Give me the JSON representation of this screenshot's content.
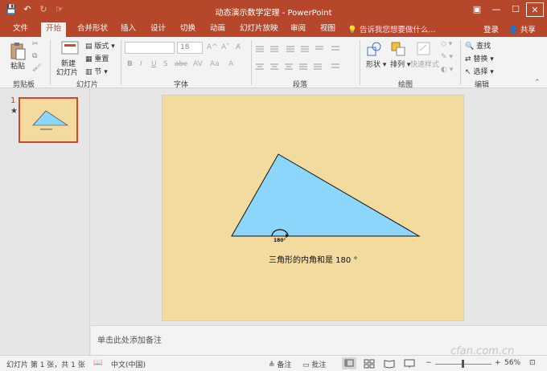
{
  "window": {
    "title": "动态演示数学定理 - PowerPoint",
    "qat": {
      "save": "💾",
      "undo": "↶",
      "redo": "↻",
      "touch": "☞"
    },
    "controls": {
      "restore_ribbon": "▣",
      "minimize": "—",
      "maximize": "☐",
      "close": "✕"
    }
  },
  "tabs": [
    {
      "label": "文件"
    },
    {
      "label": "开始"
    },
    {
      "label": "合并形状"
    },
    {
      "label": "插入"
    },
    {
      "label": "设计"
    },
    {
      "label": "切换"
    },
    {
      "label": "动画"
    },
    {
      "label": "幻灯片放映"
    },
    {
      "label": "审阅"
    },
    {
      "label": "视图"
    }
  ],
  "tell_me": "告诉我您想要做什么...",
  "login": "登录",
  "share": "共享",
  "ribbon": {
    "clipboard": {
      "paste": "粘贴",
      "label": "剪贴板"
    },
    "slides": {
      "new_slide": "新建",
      "new_slide_line2": "幻灯片",
      "layout": "版式",
      "reset": "重置",
      "section": "节",
      "label": "幻灯片"
    },
    "font": {
      "size": "18",
      "label": "字体",
      "bold": "B",
      "italic": "I",
      "underline": "U",
      "shadow": "S",
      "strike": "abc",
      "spacing": "AV",
      "case": "Aa",
      "color": "A"
    },
    "paragraph": {
      "label": "段落"
    },
    "drawing": {
      "shapes": "形状",
      "arrange": "排列",
      "quick_styles": "快速样式",
      "label": "绘图"
    },
    "editing": {
      "find": "查找",
      "replace": "替换",
      "select": "选择",
      "label": "编辑"
    }
  },
  "thumbnail": {
    "number": "1",
    "star": "★"
  },
  "slide": {
    "angle_label": "180°",
    "text": "三角形的内角和是 180 °"
  },
  "notes_placeholder": "单击此处添加备注",
  "status": {
    "slide_info": "幻灯片 第 1 张，共 1 张",
    "language": "中文(中国)",
    "notes": "备注",
    "comments": "批注",
    "zoom": "56%"
  },
  "watermark": "cfan.com.cn",
  "colors": {
    "accent": "#b7472a",
    "slide_bg": "#f3dba0",
    "triangle": "#8dd6fb"
  }
}
